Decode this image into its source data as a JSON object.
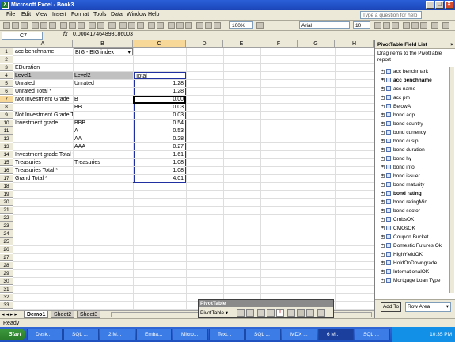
{
  "window": {
    "title": "Microsoft Excel - Book3"
  },
  "menu": {
    "items": [
      "File",
      "Edit",
      "View",
      "Insert",
      "Format",
      "Tools",
      "Data",
      "Window",
      "Help"
    ],
    "help_placeholder": "Type a question for help"
  },
  "toolbar": {
    "zoom": "100%",
    "font": "Arial",
    "size": "10"
  },
  "formula": {
    "cell_ref": "C7",
    "fx": "fx",
    "value": "0.000417464898186003"
  },
  "columns": [
    "A",
    "B",
    "C",
    "D",
    "E",
    "F",
    "G",
    "H"
  ],
  "rows": [
    "1",
    "2",
    "3",
    "4",
    "5",
    "6",
    "7",
    "8",
    "9",
    "10",
    "11",
    "12",
    "13",
    "14",
    "15",
    "16",
    "17",
    "18",
    "19",
    "20",
    "21",
    "22",
    "23",
    "24",
    "25",
    "26",
    "27",
    "28",
    "29",
    "30",
    "31",
    "32",
    "33",
    "34"
  ],
  "pivot": {
    "page_field_label": "acc benchname",
    "page_field_value": "BIG    - BIG index",
    "data_field": "EDuration",
    "level1_header": "Level1",
    "level2_header": "Level2",
    "total_header": "Total",
    "rows": [
      {
        "a": "Unrated",
        "b": "Unrated",
        "c": "1.28"
      },
      {
        "a": "Unrated Total *",
        "b": "",
        "c": "1.28"
      },
      {
        "a": "Not Investment Grade",
        "b": "B",
        "c": "0.00"
      },
      {
        "a": "",
        "b": "BB",
        "c": "0.03"
      },
      {
        "a": "Not Investment Grade Total *",
        "b": "",
        "c": "0.03"
      },
      {
        "a": "Investment grade",
        "b": "BBB",
        "c": "0.54"
      },
      {
        "a": "",
        "b": "A",
        "c": "0.53"
      },
      {
        "a": "",
        "b": "AA",
        "c": "0.28"
      },
      {
        "a": "",
        "b": "AAA",
        "c": "0.27"
      },
      {
        "a": "Investment grade Total *",
        "b": "",
        "c": "1.61"
      },
      {
        "a": "Treasuries",
        "b": "Treasuries",
        "c": "1.08"
      },
      {
        "a": "Treasuries Total *",
        "b": "",
        "c": "1.08"
      },
      {
        "a": "Grand Total *",
        "b": "",
        "c": "4.01"
      }
    ]
  },
  "sheets": [
    "Demo1",
    "Sheet2",
    "Sheet3"
  ],
  "status": "Ready",
  "field_list": {
    "title": "PivotTable Field List",
    "description": "Drag items to the PivotTable report",
    "fields": [
      {
        "name": "acc benchmark",
        "bold": false
      },
      {
        "name": "acc benchname",
        "bold": true
      },
      {
        "name": "acc name",
        "bold": false
      },
      {
        "name": "acc pm",
        "bold": false
      },
      {
        "name": "BelowA",
        "bold": false
      },
      {
        "name": "bond adp",
        "bold": false
      },
      {
        "name": "bond country",
        "bold": false
      },
      {
        "name": "bond currency",
        "bold": false
      },
      {
        "name": "bond cusip",
        "bold": false
      },
      {
        "name": "bond duration",
        "bold": false
      },
      {
        "name": "bond hy",
        "bold": false
      },
      {
        "name": "bond info",
        "bold": false
      },
      {
        "name": "bond issuer",
        "bold": false
      },
      {
        "name": "bond maturity",
        "bold": false
      },
      {
        "name": "bond rating",
        "bold": true
      },
      {
        "name": "bond ratingMin",
        "bold": false
      },
      {
        "name": "bond sector",
        "bold": false
      },
      {
        "name": "CmbsOK",
        "bold": false
      },
      {
        "name": "CMOsOK",
        "bold": false
      },
      {
        "name": "Coupon Bucket",
        "bold": false
      },
      {
        "name": "Domestic Futures Ok",
        "bold": false
      },
      {
        "name": "HighYieldOK",
        "bold": false
      },
      {
        "name": "HoldOnDowngrade",
        "bold": false
      },
      {
        "name": "InternationalOK",
        "bold": false
      },
      {
        "name": "Mortgage Loan Type",
        "bold": false
      }
    ],
    "add_to_label": "Add To",
    "area_value": "Row Area"
  },
  "pivot_toolbar": {
    "title": "PivotTable",
    "menu_label": "PivotTable ▾"
  },
  "taskbar": {
    "start_label": "Start",
    "tasks": [
      "Desk...",
      "SQL ...",
      "2 M...",
      "Emba...",
      "Micro...",
      "Text...",
      "SQL ...",
      "MDX ...",
      "6 M...",
      "SQL ..."
    ],
    "clock": "10:35 PM"
  }
}
